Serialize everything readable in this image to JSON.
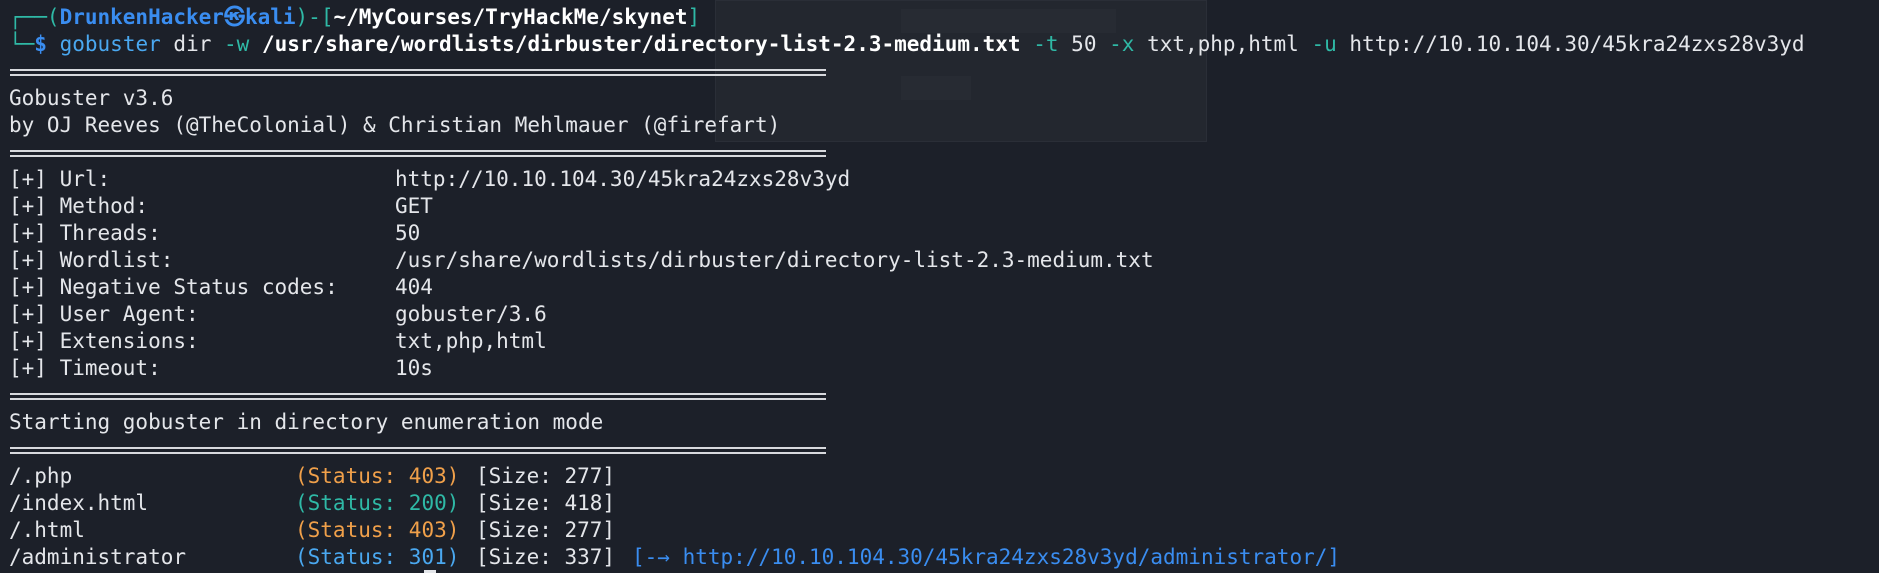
{
  "prompt": {
    "corner_top": "┌──(",
    "user": "DrunkenHacker",
    "skull": "㉿",
    "host": "kali",
    "mid": ")-[",
    "path": "~/MyCourses/TryHackMe/skynet",
    "close": "]",
    "corner_bottom": "└─",
    "symbol": "$"
  },
  "command": {
    "program": "gobuster",
    "subcommand": "dir",
    "flag_w": "-w",
    "wordlist": "/usr/share/wordlists/dirbuster/directory-list-2.3-medium.txt",
    "flag_t": "-t",
    "threads": "50",
    "flag_x": "-x",
    "extensions": "txt,php,html",
    "flag_u": "-u",
    "url": "http://10.10.104.30/45kra24zxs28v3yd"
  },
  "banner": {
    "version": "Gobuster v3.6",
    "authors": "by OJ Reeves (@TheColonial) & Christian Mehlmauer (@firefart)"
  },
  "config": [
    {
      "label": "[+] Url:",
      "value": "http://10.10.104.30/45kra24zxs28v3yd"
    },
    {
      "label": "[+] Method:",
      "value": "GET"
    },
    {
      "label": "[+] Threads:",
      "value": "50"
    },
    {
      "label": "[+] Wordlist:",
      "value": "/usr/share/wordlists/dirbuster/directory-list-2.3-medium.txt"
    },
    {
      "label": "[+] Negative Status codes:",
      "value": "404"
    },
    {
      "label": "[+] User Agent:",
      "value": "gobuster/3.6"
    },
    {
      "label": "[+] Extensions:",
      "value": "txt,php,html"
    },
    {
      "label": "[+] Timeout:",
      "value": "10s"
    }
  ],
  "start_message": "Starting gobuster in directory enumeration mode",
  "results": [
    {
      "path": "/.php",
      "status_open": "(Status: ",
      "status": "403",
      "status_close": ")",
      "size": "[Size: 277]",
      "redirect": ""
    },
    {
      "path": "/index.html",
      "status_open": "(Status: ",
      "status": "200",
      "status_close": ")",
      "size": "[Size: 418]",
      "redirect": ""
    },
    {
      "path": "/.html",
      "status_open": "(Status: ",
      "status": "403",
      "status_close": ")",
      "size": "[Size: 277]",
      "redirect": ""
    },
    {
      "path": "/administrator",
      "status_open": "(Status: ",
      "status": "301",
      "status_close": ")",
      "size": "[Size: 337]",
      "redirect": "[-→ http://10.10.104.30/45kra24zxs28v3yd/administrator/]"
    }
  ],
  "colors": {
    "background": "#1c2029",
    "status_403": "#f0a04a",
    "status_200": "#2fb9a6",
    "status_301": "#4aa8f0",
    "prompt_blue": "#3a8df0",
    "prompt_teal": "#2fb9a6"
  }
}
